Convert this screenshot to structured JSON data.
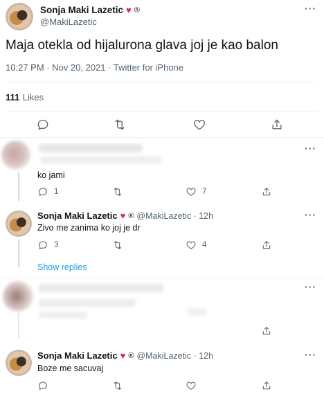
{
  "main_tweet": {
    "author_name": "Sonja Maki Lazetic",
    "author_handle": "@MakiLazetic",
    "heart_glyph": "♥",
    "reg_glyph": "®",
    "text": "Maja otekla od hijalurona glava joj je kao balon",
    "timestamp": "10:27 PM · Nov 20, 2021 · Twitter for iPhone",
    "likes_count": "111",
    "likes_label": "Likes",
    "more_label": "···"
  },
  "replies": [
    {
      "author_name": "",
      "text": "ko jami",
      "reply_count": "1",
      "like_count": "7",
      "more_label": "···"
    },
    {
      "author_name": "Sonja Maki Lazetic",
      "author_meta": "@MakiLazetic · 12h",
      "text": "Zivo me zanima ko joj je dr",
      "reply_count": "3",
      "like_count": "4",
      "more_label": "···",
      "show_replies": "Show replies"
    },
    {
      "author_name": "",
      "text": "",
      "more_label": "···"
    },
    {
      "author_name": "Sonja Maki Lazetic",
      "author_meta": "@MakiLazetic · 12h",
      "text": "Boze me sacuvaj",
      "more_label": "···"
    }
  ],
  "colors": {
    "link": "#1d9bf0",
    "heart": "#e0245e",
    "muted": "#536471",
    "text": "#0f1419"
  },
  "icons": [
    "reply-icon",
    "retweet-icon",
    "like-icon",
    "share-icon",
    "more-icon"
  ]
}
